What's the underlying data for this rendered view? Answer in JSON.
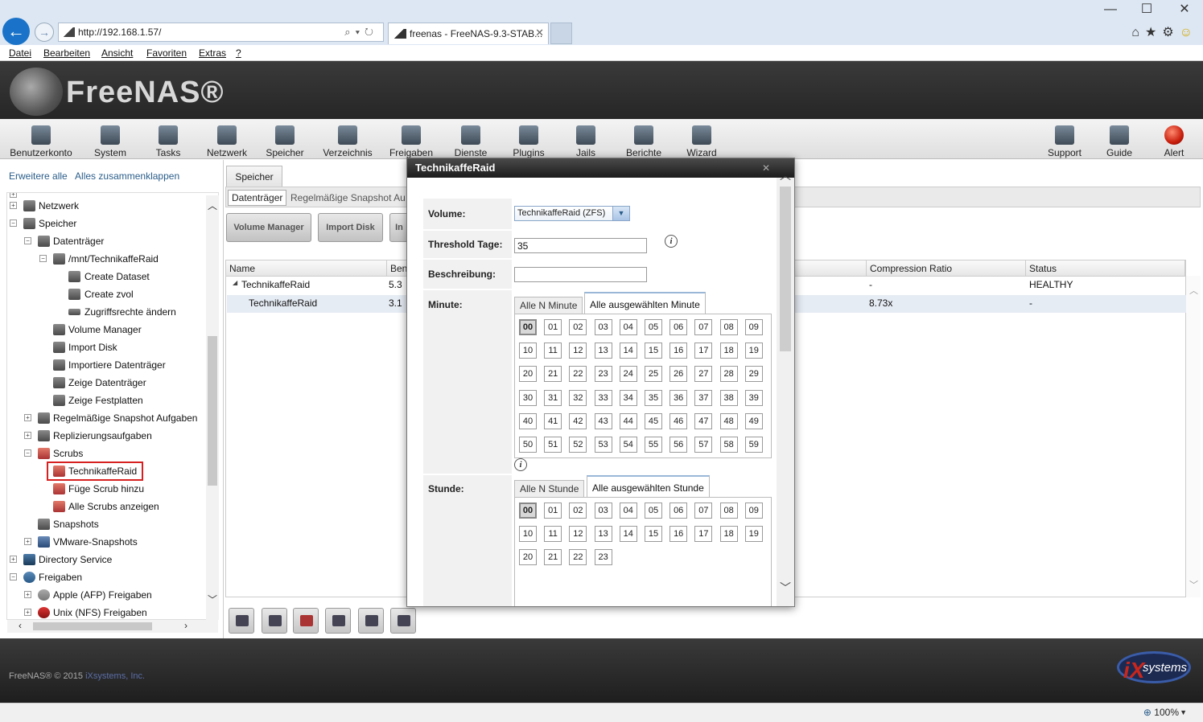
{
  "browser": {
    "url": "http://192.168.1.57/",
    "tab_title": "freenas - FreeNAS-9.3-STAB...",
    "menu": [
      "Datei",
      "Bearbeiten",
      "Ansicht",
      "Favoriten",
      "Extras",
      "?"
    ],
    "zoom": "100%"
  },
  "header": {
    "logo": "FreeNAS®"
  },
  "toolbar": {
    "items": [
      "Benutzerkonto",
      "System",
      "Tasks",
      "Netzwerk",
      "Speicher",
      "Verzeichnis",
      "Freigaben",
      "Dienste",
      "Plugins",
      "Jails",
      "Berichte",
      "Wizard"
    ],
    "right_items": [
      "Support",
      "Guide",
      "Alert"
    ]
  },
  "sidebar": {
    "expand_all": "Erweitere alle",
    "collapse_all": "Alles zusammenklappen",
    "tree": [
      "Netzwerk",
      "Speicher",
      "Datenträger",
      "/mnt/TechnikaffeRaid",
      "Create Dataset",
      "Create zvol",
      "Zugriffsrechte ändern",
      "Volume Manager",
      "Import Disk",
      "Importiere Datenträger",
      "Zeige Datenträger",
      "Zeige Festplatten",
      "Regelmäßige Snapshot Aufgaben",
      "Replizierungsaufgaben",
      "Scrubs",
      "TechnikaffeRaid",
      "Füge Scrub hinzu",
      "Alle Scrubs anzeigen",
      "Snapshots",
      "VMware-Snapshots",
      "Directory Service",
      "Freigaben",
      "Apple (AFP) Freigaben",
      "Unix (NFS) Freigaben"
    ]
  },
  "main": {
    "tab": "Speicher",
    "subtab_active": "Datenträger",
    "subtab_next": "Regelmäßige Snapshot Au",
    "buttons": [
      "Volume Manager",
      "Import Disk",
      "In"
    ],
    "columns": {
      "name": "Name",
      "ben": "Ben",
      "compression": "Compression Ratio",
      "status": "Status"
    },
    "rows": [
      {
        "name": "TechnikaffeRaid",
        "ben": "5.3",
        "compression": "-",
        "status": "HEALTHY"
      },
      {
        "name": "TechnikaffeRaid",
        "ben": "3.1",
        "compression": "8.73x",
        "status": "-"
      }
    ]
  },
  "footer": {
    "copyright": "FreeNAS® © 2015 ",
    "company": "iXsystems, Inc.",
    "ix_logo": "systems"
  },
  "dialog": {
    "title": "TechnikaffeRaid",
    "volume_label": "Volume:",
    "volume_value": "TechnikaffeRaid (ZFS)",
    "threshold_label": "Threshold Tage:",
    "threshold_value": "35",
    "description_label": "Beschreibung:",
    "description_value": "",
    "minute_label": "Minute:",
    "minute_tab_n": "Alle N Minute",
    "minute_tab_selected": "Alle ausgewählten Minute",
    "minutes_selected": "00",
    "hour_label": "Stunde:",
    "hour_tab_n": "Alle N Stunde",
    "hour_tab_selected": "Alle ausgewählten Stunde",
    "hours_selected": "00"
  }
}
